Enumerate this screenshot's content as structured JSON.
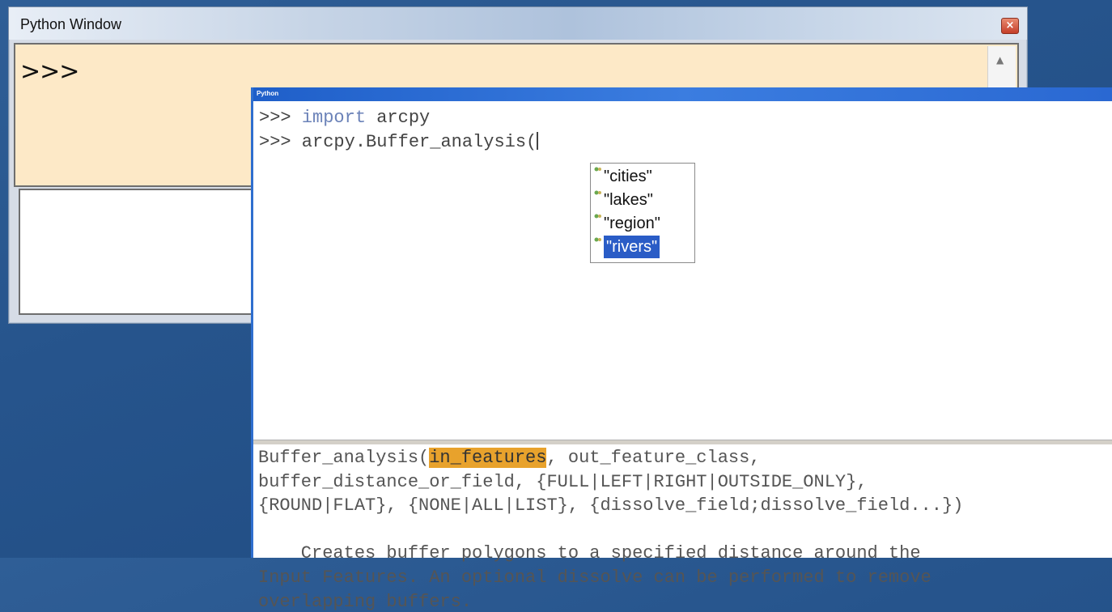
{
  "back_window": {
    "title": "Python Window",
    "close_label": "×",
    "prompt": ">>>"
  },
  "front_window": {
    "title": "Python",
    "code_lines": [
      {
        "prompt": ">>>",
        "keyword": "import",
        "rest": " arcpy"
      },
      {
        "prompt": ">>>",
        "keyword": "",
        "rest": " arcpy.Buffer_analysis("
      }
    ],
    "autocomplete": {
      "items": [
        "\"cities\"",
        "\"lakes\"",
        "\"region\"",
        "\"rivers\""
      ],
      "selected_index": 3,
      "item_icon": "parameter-icon"
    },
    "help": {
      "signature_prefix": "Buffer_analysis(",
      "signature_highlight": "in_features",
      "signature_rest": ", out_feature_class,",
      "signature_line2": "buffer_distance_or_field, {FULL|LEFT|RIGHT|OUTSIDE_ONLY},",
      "signature_line3": "{ROUND|FLAT}, {NONE|ALL|LIST}, {dissolve_field;dissolve_field...})",
      "description_line1": "    Creates buffer polygons to a specified distance around the",
      "description_line2": "Input Features. An optional dissolve can be performed to remove",
      "description_line3": "overlapping buffers."
    }
  },
  "colors": {
    "editor_bg": "#fde9c7",
    "highlight": "#e8a22c",
    "selection": "#2a5cc6",
    "keyword": "#6b82b8"
  }
}
